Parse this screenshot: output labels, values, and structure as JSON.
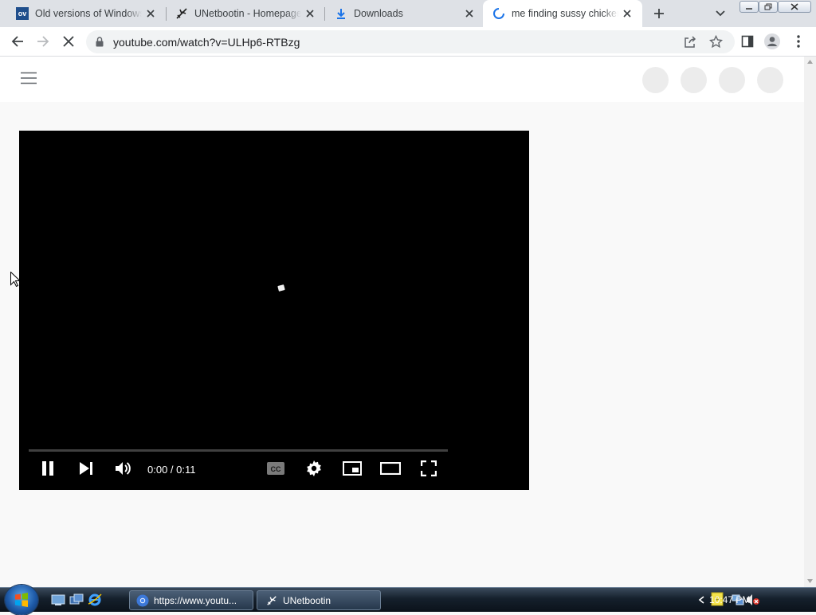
{
  "browser": {
    "tabs": [
      {
        "title": "Old versions of Windows",
        "favicon": "ov-icon",
        "favicon_text": "ov",
        "active": false
      },
      {
        "title": "UNetbootin - Homepage",
        "favicon": "plane-icon",
        "active": false
      },
      {
        "title": "Downloads",
        "favicon": "download-icon",
        "active": false
      },
      {
        "title": "me finding sussy chicken",
        "favicon": "loading-spinner-icon",
        "active": true
      }
    ],
    "address": "youtube.com/watch?v=ULHp6-RTBzg"
  },
  "player": {
    "timecode": "0:00 / 0:11",
    "progress_fraction": 0,
    "cc_label": "CC"
  },
  "taskbar": {
    "buttons": [
      {
        "label": "https://www.youtu...",
        "icon": "chrome-icon"
      },
      {
        "label": "UNetbootin",
        "icon": "unetbootin-icon"
      }
    ],
    "clock": "10:47 PM"
  },
  "colors": {
    "accent_blue": "#1a73e8",
    "ov_brand": "#1f4e8c",
    "download_blue": "#1a73e8"
  }
}
